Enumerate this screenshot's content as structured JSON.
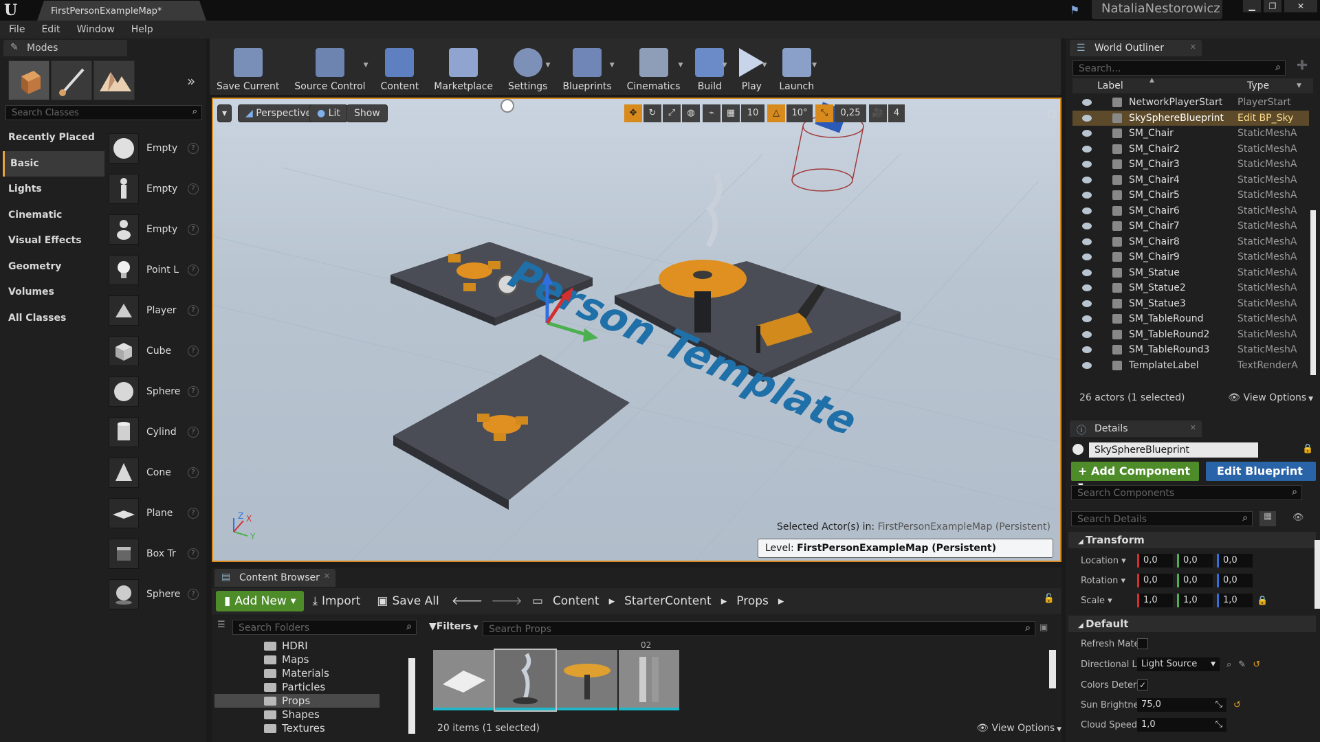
{
  "titlebar": {
    "tab_title": "FirstPersonExampleMap*",
    "user": "NataliaNestorowicz"
  },
  "menu": [
    "File",
    "Edit",
    "Window",
    "Help"
  ],
  "modes": {
    "tab_label": "Modes",
    "search_placeholder": "Search Classes",
    "categories": [
      "Recently Placed",
      "Basic",
      "Lights",
      "Cinematic",
      "Visual Effects",
      "Geometry",
      "Volumes",
      "All Classes"
    ],
    "selected_category": "Basic",
    "items": [
      "Empty",
      "Empty",
      "Empty",
      "Point L",
      "Player",
      "Cube",
      "Sphere",
      "Cylind",
      "Cone",
      "Plane",
      "Box Tr",
      "Sphere"
    ]
  },
  "toolbar": {
    "buttons": [
      "Save Current",
      "Source Control",
      "Content",
      "Marketplace",
      "Settings",
      "Blueprints",
      "Cinematics",
      "Build",
      "Play",
      "Launch"
    ]
  },
  "viewport": {
    "perspective": "Perspective",
    "lit": "Lit",
    "show": "Show",
    "grid_snap": "10",
    "rot_snap": "10°",
    "scale_snap": "0,25",
    "cam_speed": "4",
    "scene_text": "Person Template",
    "selected_actor_label": "Selected Actor(s) in:",
    "selected_actor_map": "FirstPersonExampleMap (Persistent)",
    "level_label": "Level:",
    "level_value": "FirstPersonExampleMap (Persistent)",
    "axis_x": "X",
    "axis_y": "Y",
    "axis_z": "Z"
  },
  "content_browser": {
    "tab_label": "Content Browser",
    "add_new": "Add New",
    "import": "Import",
    "save_all": "Save All",
    "breadcrumb": [
      "Content",
      "StarterContent",
      "Props"
    ],
    "folder_search_placeholder": "Search Folders",
    "folders": [
      "HDRI",
      "Maps",
      "Materials",
      "Particles",
      "Props",
      "Shapes",
      "Textures"
    ],
    "selected_folder": "Props",
    "filters": "Filters",
    "asset_search_placeholder": "Search Props",
    "asset_label_partial": "02",
    "items_count": "20 items (1 selected)",
    "view_options": "View Options"
  },
  "outliner": {
    "tab_label": "World Outliner",
    "search_placeholder": "Search...",
    "col_label": "Label",
    "col_type": "Type",
    "rows": [
      {
        "label": "NetworkPlayerStart",
        "type": "PlayerStart"
      },
      {
        "label": "SkySphereBlueprint",
        "type": "Edit BP_Sky"
      },
      {
        "label": "SM_Chair",
        "type": "StaticMeshA"
      },
      {
        "label": "SM_Chair2",
        "type": "StaticMeshA"
      },
      {
        "label": "SM_Chair3",
        "type": "StaticMeshA"
      },
      {
        "label": "SM_Chair4",
        "type": "StaticMeshA"
      },
      {
        "label": "SM_Chair5",
        "type": "StaticMeshA"
      },
      {
        "label": "SM_Chair6",
        "type": "StaticMeshA"
      },
      {
        "label": "SM_Chair7",
        "type": "StaticMeshA"
      },
      {
        "label": "SM_Chair8",
        "type": "StaticMeshA"
      },
      {
        "label": "SM_Chair9",
        "type": "StaticMeshA"
      },
      {
        "label": "SM_Statue",
        "type": "StaticMeshA"
      },
      {
        "label": "SM_Statue2",
        "type": "StaticMeshA"
      },
      {
        "label": "SM_Statue3",
        "type": "StaticMeshA"
      },
      {
        "label": "SM_TableRound",
        "type": "StaticMeshA"
      },
      {
        "label": "SM_TableRound2",
        "type": "StaticMeshA"
      },
      {
        "label": "SM_TableRound3",
        "type": "StaticMeshA"
      },
      {
        "label": "TemplateLabel",
        "type": "TextRenderA"
      }
    ],
    "selected_row": "SkySphereBlueprint",
    "footer": "26 actors (1 selected)",
    "view_options": "View Options"
  },
  "details": {
    "tab_label": "Details",
    "actor_name": "SkySphereBlueprint",
    "add_component": "+ Add Component",
    "edit_blueprint": "Edit Blueprint",
    "search_components_placeholder": "Search Components",
    "search_details_placeholder": "Search Details",
    "transform": "Transform",
    "location_label": "Location",
    "rotation_label": "Rotation",
    "scale_label": "Scale",
    "location": [
      "0,0",
      "0,0",
      "0,0"
    ],
    "rotation": [
      "0,0",
      "0,0",
      "0,0"
    ],
    "scale": [
      "1,0",
      "1,0",
      "1,0"
    ],
    "default": "Default",
    "refresh_material": "Refresh Materi",
    "directional_light": "Directional Ligh",
    "directional_light_value": "Light Source",
    "colors_determined": "Colors Determi",
    "sun_brightness": "Sun Brightness",
    "sun_brightness_value": "75,0",
    "cloud_speed": "Cloud Speed",
    "cloud_speed_value": "1,0"
  },
  "colors": {
    "accent": "#d88a1c",
    "green": "#4e8c2a",
    "blue": "#2a64a8",
    "axis_x": "#d32f2f",
    "axis_y": "#4caf50",
    "axis_z": "#2f6fe0"
  }
}
